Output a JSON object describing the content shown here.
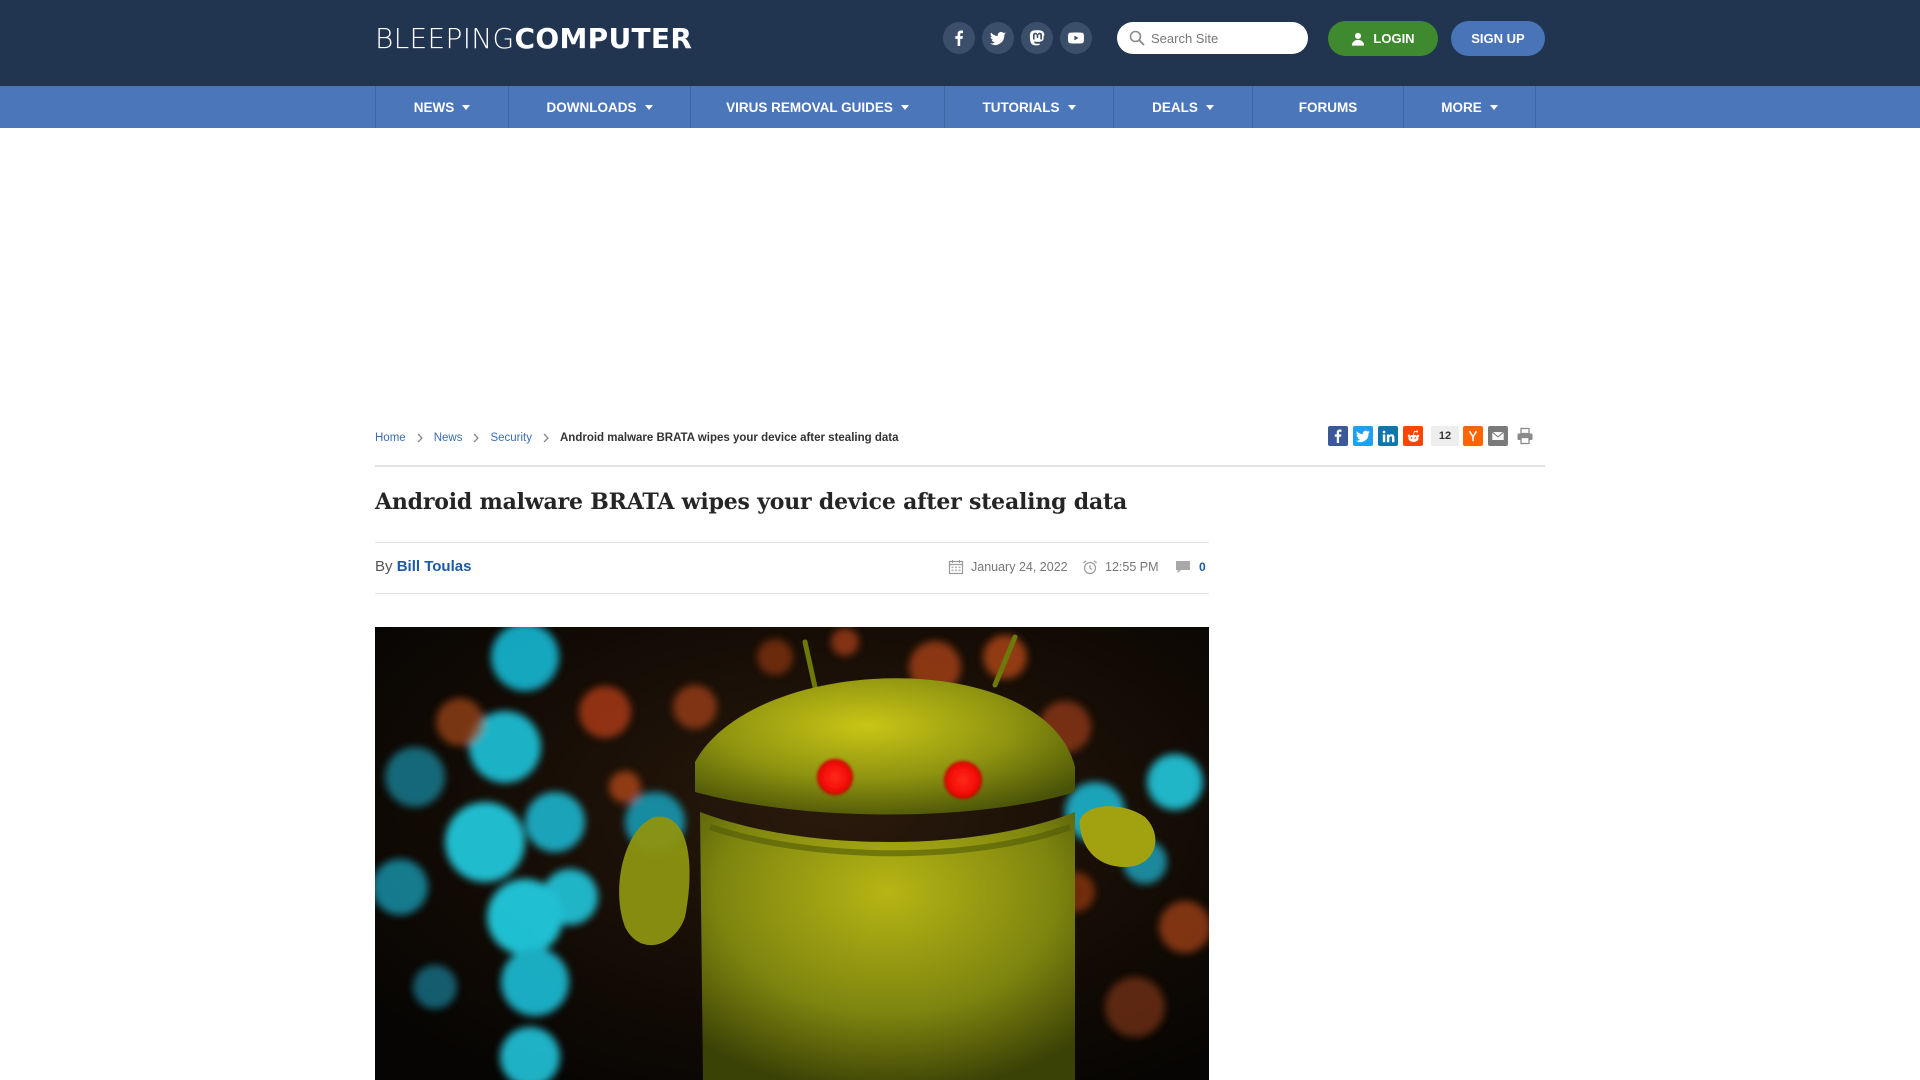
{
  "header": {
    "logo_light": "BLEEPING",
    "logo_bold": "COMPUTER",
    "social": [
      "facebook-icon",
      "twitter-icon",
      "mastodon-icon",
      "youtube-icon"
    ],
    "search_placeholder": "Search Site",
    "login_label": "LOGIN",
    "signup_label": "SIGN UP"
  },
  "nav": {
    "items": [
      {
        "label": "NEWS",
        "dropdown": true
      },
      {
        "label": "DOWNLOADS",
        "dropdown": true
      },
      {
        "label": "VIRUS REMOVAL GUIDES",
        "dropdown": true
      },
      {
        "label": "TUTORIALS",
        "dropdown": true
      },
      {
        "label": "DEALS",
        "dropdown": true
      },
      {
        "label": "FORUMS",
        "dropdown": false
      },
      {
        "label": "MORE",
        "dropdown": true
      }
    ]
  },
  "breadcrumb": {
    "home": "Home",
    "news": "News",
    "security": "Security",
    "current": "Android malware BRATA wipes your device after stealing data"
  },
  "share": {
    "count": "12",
    "icons": [
      "facebook-share-icon",
      "twitter-share-icon",
      "linkedin-share-icon",
      "reddit-share-icon",
      "hackernews-share-icon",
      "email-share-icon",
      "print-icon"
    ]
  },
  "article": {
    "title": "Android malware BRATA wipes your device after stealing data",
    "by_label": "By",
    "author": "Bill Toulas",
    "date": "January 24, 2022",
    "time": "12:55 PM",
    "comments": "0"
  },
  "colors": {
    "header_bg": "#213450",
    "nav_bg": "#4b76b9",
    "login_green": "#3f8a2f",
    "signup_blue": "#4a74b8",
    "link_blue": "#1d5aa8"
  }
}
